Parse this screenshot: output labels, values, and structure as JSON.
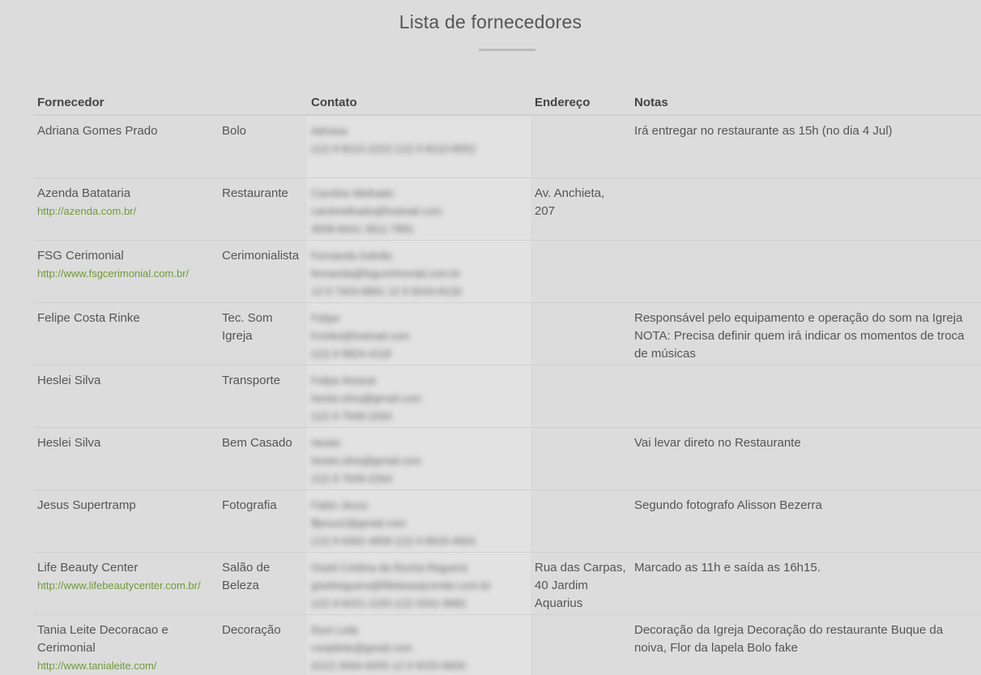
{
  "page": {
    "title": "Lista de fornecedores"
  },
  "table": {
    "headers": {
      "supplier": "Fornecedor",
      "category": "",
      "contact": "Contato",
      "address": "Endereço",
      "notes": "Notas"
    },
    "rows": [
      {
        "name": "Adriana Gomes Prado",
        "url": "",
        "category": "Bolo",
        "contact_name": "Adriana",
        "contact_email": "",
        "contact_phone": "(12) 9 8210-2222 (12) 9 8210-8052",
        "address": "",
        "notes": "Irá entregar no restaurante as 15h (no dia 4 Jul)"
      },
      {
        "name": "Azenda Batataria",
        "url": "http://azenda.com.br/",
        "category": "Restaurante",
        "contact_name": "Caroline Melhado",
        "contact_email": "carolmelhado@hotmail.com",
        "contact_phone": "3939-8441 3911-7891",
        "address": "Av. Anchieta, 207",
        "notes": ""
      },
      {
        "name": "FSG Cerimonial",
        "url": "http://www.fsgcerimonial.com.br/",
        "category": "Cerimonialista",
        "contact_name": "Fernanda Galvão",
        "contact_email": "fernanda@fsgcerimonial.com.br",
        "contact_phone": "12 9 7403-8891 12 9 9243-8133",
        "address": "",
        "notes": ""
      },
      {
        "name": "Felipe Costa Rinke",
        "url": "",
        "category": "Tec. Som Igreja",
        "contact_name": "Felipe",
        "contact_email": "fcrinke@hotmail.com",
        "contact_phone": "(12) 9 9824-4118",
        "address": "",
        "notes": "Responsável pelo equipamento e operação do som na Igreja NOTA: Precisa definir quem irá indicar os momentos de troca de músicas"
      },
      {
        "name": "Heslei Silva",
        "url": "",
        "category": "Transporte",
        "contact_name": "Felipe Amaral",
        "contact_email": "heslei.silva@gmail.com",
        "contact_phone": "(12) 9 7649-2264",
        "address": "",
        "notes": ""
      },
      {
        "name": "Heslei Silva",
        "url": "",
        "category": "Bem Casado",
        "contact_name": "Heslei",
        "contact_email": "heslei.silva@gmail.com",
        "contact_phone": "(12) 9 7649-2264",
        "address": "",
        "notes": "Vai levar direto no Restaurante"
      },
      {
        "name": "Jesus Supertramp",
        "url": "",
        "category": "Fotografia",
        "contact_name": "Fabio Jesus",
        "contact_email": "ffjesus2@gmail.com",
        "contact_phone": "(12) 9 6362-4958 (12) 9 8633-4604",
        "address": "",
        "notes": "Segundo fotografo Alisson Bezerra"
      },
      {
        "name": "Life Beauty Center",
        "url": "http://www.lifebeautycenter.com.br/",
        "category": "Salão de Beleza",
        "contact_name": "Giseli Cristina da Rocha Reguera",
        "contact_email": "giselireguera@lifebeautycenter.com.br",
        "contact_phone": "(12) 9 8151-1150 (12) 3341-9982",
        "address": "Rua das Carpas, 40 Jardim Aquarius",
        "notes": "Marcado as 11h e saída as 16h15."
      },
      {
        "name": "Tania Leite Decoracao e Cerimonial",
        "url": "http://www.tanialeite.com/",
        "category": "Decoração",
        "contact_name": "Roni Leite",
        "contact_email": "ronipleite@gmail.com",
        "contact_phone": "(012) 3934-9255 12 9 9220-9600",
        "address": "",
        "notes": "Decoração da Igreja Decoração do restaurante Buque da noiva, Flor da lapela Bolo fake"
      }
    ]
  },
  "colors": {
    "background": "#dcdcdc",
    "link": "#6f9a3a",
    "text": "#555555"
  }
}
